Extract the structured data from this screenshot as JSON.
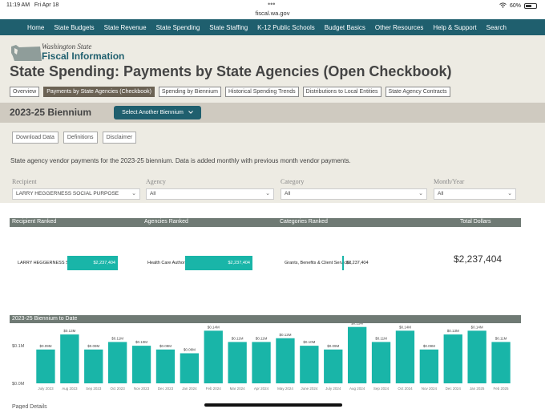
{
  "status": {
    "time": "11:19 AM",
    "date": "Fri Apr 18",
    "url": "fiscal.wa.gov",
    "battery": "60%",
    "battery_level": 0.6
  },
  "nav": [
    "Home",
    "State Budgets",
    "State Revenue",
    "State Spending",
    "State Staffing",
    "K-12 Public Schools",
    "Budget Basics",
    "Other Resources",
    "Help & Support",
    "Search"
  ],
  "logo": {
    "line1": "Washington State",
    "line2": "Fiscal Information"
  },
  "page_title": "State Spending: Payments by State Agencies (Open Checkbook)",
  "subtabs": [
    "Overview",
    "Payments by State Agencies (Checkbook)",
    "Spending by Biennium",
    "Historical Spending Trends",
    "Distributions to Local Entities",
    "State Agency Contracts"
  ],
  "active_subtab": 1,
  "biennium": {
    "label": "2023-25 Biennium",
    "select_label": "Select Another Biennium"
  },
  "actions": [
    "Download Data",
    "Definitions",
    "Disclaimer"
  ],
  "description": "State agency vendor payments for the 2023-25 biennium. Data is added monthly with previous month vendor payments.",
  "filters": [
    {
      "label": "Recipient",
      "value": "LARRY HEGGERNESS SOCIAL PURPOSE"
    },
    {
      "label": "Agency",
      "value": "All"
    },
    {
      "label": "Category",
      "value": "All"
    },
    {
      "label": "Month/Year",
      "value": "All"
    }
  ],
  "ranked": {
    "headers": [
      "Recipient Ranked",
      "Agencies Ranked",
      "Categories Ranked",
      "Total Dollars"
    ],
    "recipient": {
      "name": "LARRY HEGGERNESS S...",
      "value": "$2,237,404"
    },
    "agency": {
      "name": "Health Care Authority",
      "value": "$2,237,404"
    },
    "category": {
      "name": "Grants, Benefits & Client Services",
      "value": "$2,237,404"
    },
    "total": "$2,237,404"
  },
  "chart_data": {
    "type": "bar",
    "title": "2023-25  Biennium to Date",
    "categories": [
      "July 2023",
      "Aug 2023",
      "Sep 2023",
      "Oct 2023",
      "Nov 2023",
      "Dec 2023",
      "Jan 2024",
      "Feb 2024",
      "Mar 2024",
      "Apr 2024",
      "May 2024",
      "June 2024",
      "July 2024",
      "Aug 2024",
      "Sep 2024",
      "Oct 2024",
      "Nov 2024",
      "Dec 2024",
      "Jan 2025",
      "Feb 2025"
    ],
    "values": [
      0.09,
      0.13,
      0.09,
      0.11,
      0.1,
      0.09,
      0.08,
      0.14,
      0.11,
      0.11,
      0.12,
      0.1,
      0.09,
      0.15,
      0.11,
      0.14,
      0.09,
      0.13,
      0.14,
      0.11
    ],
    "labels": [
      "$0.09M",
      "$0.13M",
      "$0.09M",
      "$0.11M",
      "$0.10M",
      "$0.09M",
      "$0.08M",
      "$0.14M",
      "$0.11M",
      "$0.11M",
      "$0.12M",
      "$0.10M",
      "$0.09M",
      "$0.15M",
      "$0.11M",
      "$0.14M",
      "$0.09M",
      "$0.13M",
      "$0.14M",
      "$0.11M"
    ],
    "y_ticks": [
      {
        "value": 0.1,
        "label": "$0.1M"
      },
      {
        "value": 0.0,
        "label": "$0.0M"
      }
    ],
    "ylim": [
      0,
      0.16
    ],
    "color": "#19b5a8",
    "grid": false
  },
  "section_partial": "Paged Details"
}
